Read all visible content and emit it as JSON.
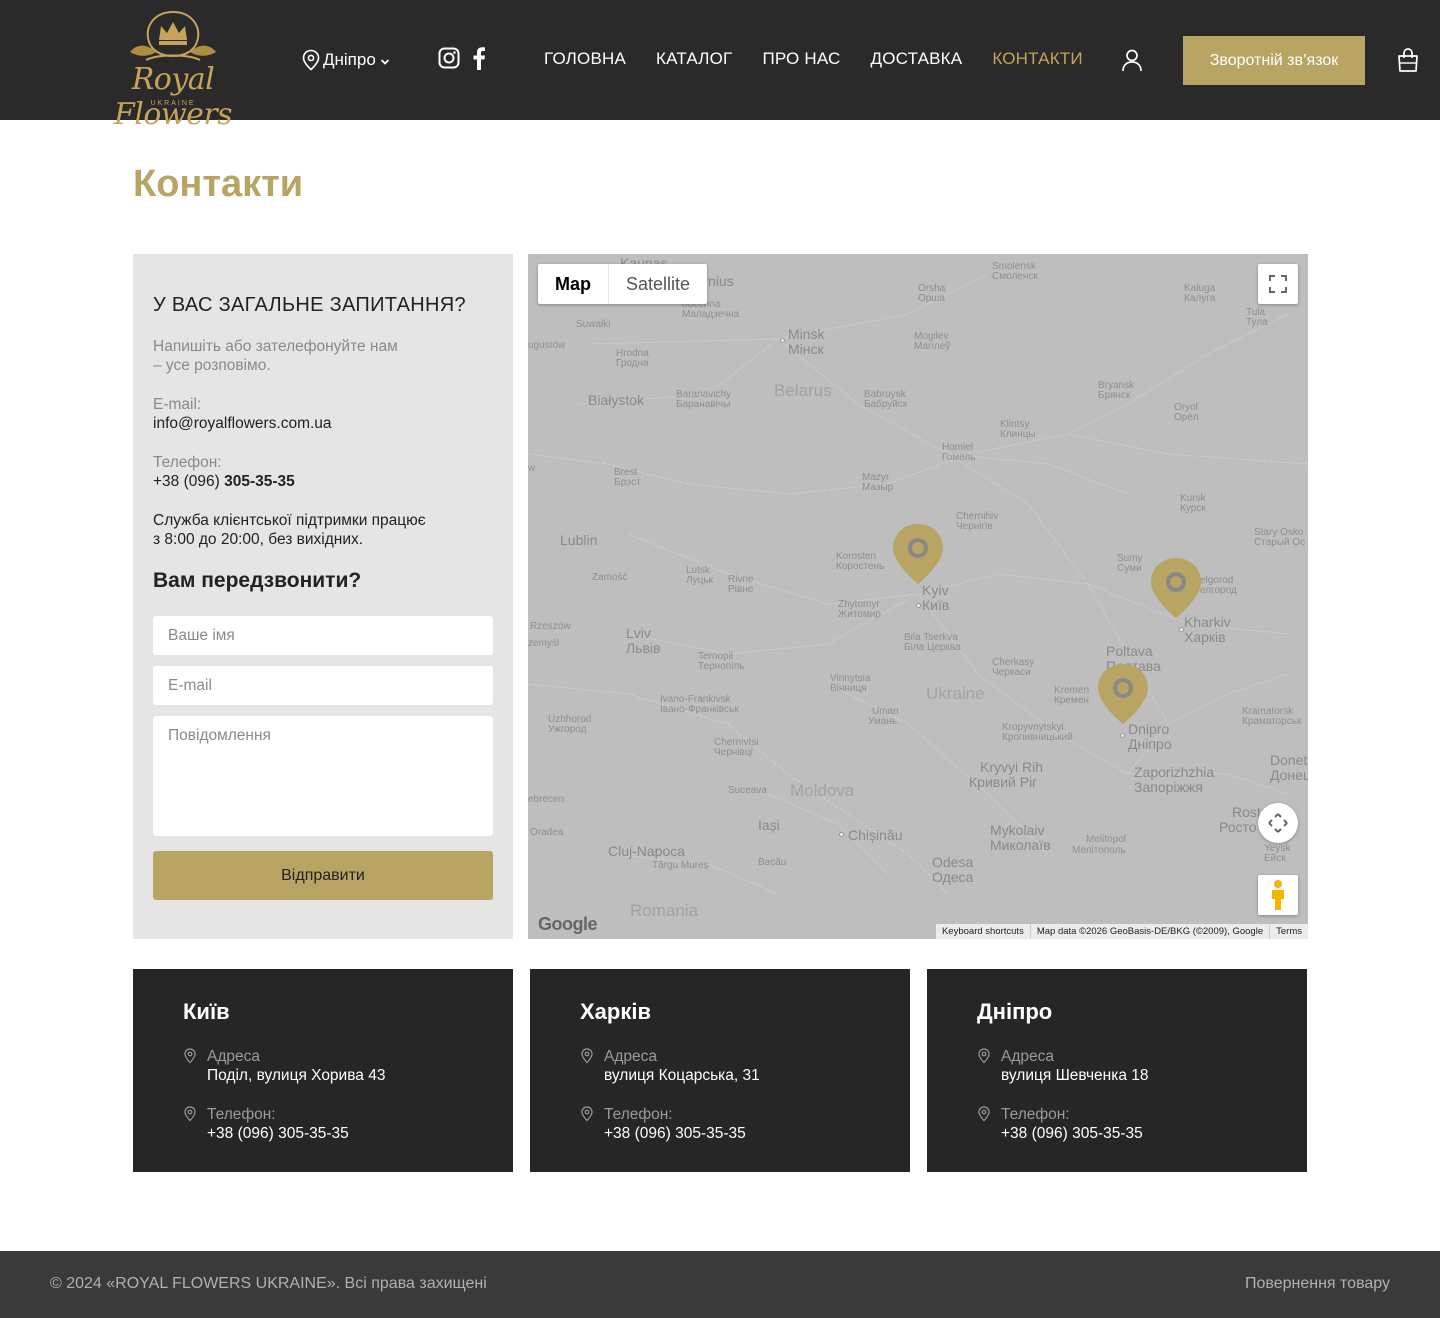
{
  "brand": {
    "name": "Royal Flowers",
    "subtitle": "UKRAINE"
  },
  "header": {
    "city": "Дніпро",
    "nav": [
      "ГОЛОВНА",
      "КАТАЛОГ",
      "ПРО НАС",
      "ДОСТАВКА",
      "КОНТАКТИ"
    ],
    "active_nav": "КОНТАКТИ",
    "callback_label": "Зворотній зв’язок"
  },
  "page": {
    "title": "Контакти"
  },
  "contact_panel": {
    "heading": "У ВАС ЗАГАЛЬНЕ ЗАПИТАННЯ?",
    "intro_line1": "Напишіть або зателефонуйте нам",
    "intro_line2": "– усе розповімо.",
    "email_label": "E-mail:",
    "email_value": "info@royalflowers.com.ua",
    "phone_label": "Телефон:",
    "phone_prefix": "+38 (096) ",
    "phone_number": "305-35-35",
    "support_line1": "Служба клієнтської підтримки працює",
    "support_line2": "з 8:00 до 20:00, без вихідних.",
    "callback_heading": "Вам передзвонити?",
    "name_placeholder": "Ваше імя",
    "email_placeholder": "E-mail",
    "message_placeholder": "Повідомлення",
    "submit_label": "Відправити"
  },
  "map": {
    "type_map": "Map",
    "type_satellite": "Satellite",
    "logo": "Google",
    "keyboard_shortcuts": "Keyboard shortcuts",
    "map_data": "Map data ©2026 GeoBasis-DE/BKG (©2009), Google",
    "terms": "Terms",
    "labels": {
      "kaunas": "Kaunas",
      "vilnius": "nius",
      "smolensk": "Smolensk",
      "smolensk_cyr": "Смоленск",
      "kaluga": "Kaluga",
      "kaluga_cyr": "Калуга",
      "tula": "Tula",
      "tula_cyr": "Тула",
      "orsha": "Orsha",
      "orsha_cyr": "Орша",
      "suwalki": "Suwałki",
      "minsk": "Minsk",
      "minsk_cyr": "Мінск",
      "mogilev": "Mogilev",
      "mogilev_cyr": "Магілеў",
      "molodechno": "odechna",
      "molodechno_cyr": "Маладзечна",
      "augustow": "ugustów",
      "hrodna": "Hrodna",
      "hrodna_cyr": "Гродна",
      "bialystok": "Białystok",
      "baranavichy": "Baranavichy",
      "baranavichy_cyr": "Баранавічы",
      "belarus": "Belarus",
      "babruysk": "Babruysk",
      "babruysk_cyr": "Бабруйск",
      "bryansk": "Bryansk",
      "bryansk_cyr": "Брянск",
      "oryol": "Oryol",
      "oryol_cyr": "Орёл",
      "klintsy": "Klintsy",
      "klintsy_cyr": "Клинцы",
      "homiel": "Homiel",
      "homiel_cyr": "Гомель",
      "brest": "Brest",
      "brest_cyr": "Брэст",
      "mazyr": "Mazyr",
      "mazyr_cyr": "Мазыр",
      "w": "w",
      "kursk": "Kursk",
      "kursk_cyr": "Курск",
      "chernihiv": "Chernihiv",
      "chernihiv_cyr": "Чернігів",
      "stary_oskol": "Stary Osko",
      "stary_oskol_cyr": "Старый Ос",
      "lublin": "Lublin",
      "korosten": "Korosten",
      "korosten_cyr": "Коростень",
      "sumy": "Sumy",
      "sumy_cyr": "Суми",
      "belgorod": "elgorod",
      "belgorod_cyr": "елгород",
      "zamosc": "Zamość",
      "lutsk": "Lutsk",
      "lutsk_cyr": "Луцьк",
      "rivne": "Rivne",
      "rivne_cyr": "Рівне",
      "kyiv": "Kyiv",
      "kyiv_cyr": "Київ",
      "zhytomyr": "Zhytomyr",
      "zhytomyr_cyr": "Житомир",
      "kharkiv": "Kharkiv",
      "kharkiv_cyr": "Харків",
      "rzeszow": "Rzeszów",
      "przemysl": "zemyśl",
      "lviv": "Lviv",
      "lviv_cyr": "Львів",
      "bila_tserkva": "Bila Tserkva",
      "bila_tserkva_cyr": "Біла Церква",
      "poltava": "Poltava",
      "poltava_cyr": "Полтава",
      "ternopil": "Ternopil",
      "ternopil_cyr": "Тернопіль",
      "cherkasy": "Cherkasy",
      "cherkasy_cyr": "Черкаси",
      "vinnytsia": "Vinnytsia",
      "vinnytsia_cyr": "Вінниця",
      "kremenchuk": "Kremen",
      "kremenchuk_cyr": "Кремен",
      "ukraine": "Ukraine",
      "ivano": "Ivano-Frankivsk",
      "ivano_cyr": "Івано-Франківськ",
      "kramatorsk": "Kramatorsk",
      "kramatorsk_cyr": "Краматорськ",
      "uzhhorod": "Uzhhorod",
      "uzhhorod_cyr": "Ужгород",
      "uman": "Uman",
      "uman_cyr": "Умань",
      "kropyvnytskyi": "Kropyvnytskyi",
      "kropyvnytskyi_cyr": "Кропивницький",
      "dnipro": "Dnipro",
      "dnipro_cyr": "Дніпро",
      "chernivtsi": "Chernivtsi",
      "chernivtsi_cyr": "Чернівці",
      "donetsk": "Donetsk",
      "donetsk_cyr": "Донецьк",
      "kryvyi_rih": "Kryvyi Rih",
      "kryvyi_rih_cyr": "Кривий Ріг",
      "zaporizhzhia": "Zaporizhzhia",
      "zaporizhzhia_cyr": "Запоріжжя",
      "suceava": "Suceava",
      "moldova": "Moldova",
      "debrecen": "ebrecen",
      "iasi": "Iași",
      "chisinau": "Chișinău",
      "mykolaiv": "Mykolaiv",
      "mykolaiv_cyr": "Миколаїв",
      "rostov": "Rost",
      "rostov_cyr": "Росто",
      "oradea": "Oradea",
      "melitopol": "Melitopol",
      "melitopol_cyr": "Мелітополь",
      "yeysk": "Yeysk",
      "yeysk_cyr": "Ейск",
      "cluj": "Cluj-Napoca",
      "targu": "Târgu Mureș",
      "bacau": "Bacău",
      "odesa": "Odesa",
      "odesa_cyr": "Одеса",
      "romania": "Romania"
    }
  },
  "offices": [
    {
      "city": "Київ",
      "address_label": "Адреса",
      "address": "Поділ, вулиця Хорива 43",
      "phone_label": "Телефон:",
      "phone": "+38 (096) 305-35-35"
    },
    {
      "city": "Харків",
      "address_label": "Адреса",
      "address": "вулиця Коцарська, 31",
      "phone_label": "Телефон:",
      "phone": "+38 (096) 305-35-35"
    },
    {
      "city": "Дніпро",
      "address_label": "Адреса",
      "address": "вулиця Шевченка 18",
      "phone_label": "Телефон:",
      "phone": "+38 (096) 305-35-35"
    }
  ],
  "footer": {
    "copyright": "© 2024 «ROYAL FLOWERS UKRAINE». Всі права захищені",
    "returns": "Повернення товару"
  },
  "colors": {
    "gold": "#b8a463",
    "dark": "#2a2a2a",
    "card": "#262626",
    "panel": "#e5e5e5",
    "map": "#bebebe"
  }
}
